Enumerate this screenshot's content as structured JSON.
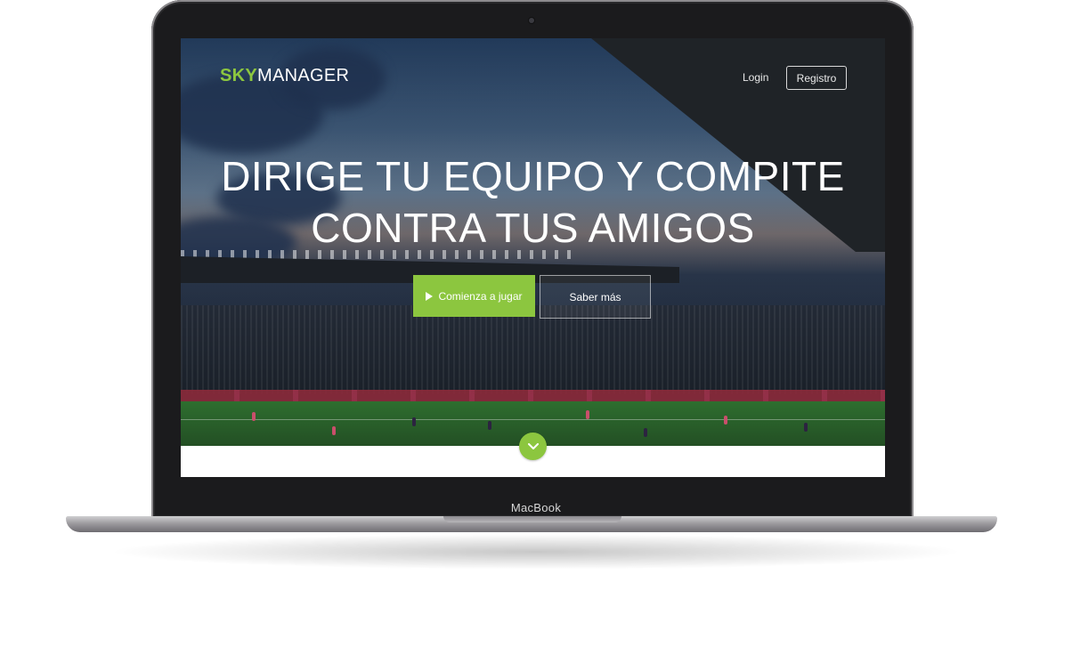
{
  "device": {
    "brand_label": "MacBook"
  },
  "header": {
    "logo_accent": "SKY",
    "logo_rest": "MANAGER",
    "login_label": "Login",
    "register_label": "Registro"
  },
  "hero": {
    "headline_line1": "DIRIGE TU EQUIPO Y COMPITE",
    "headline_line2": "CONTRA TUS AMIGOS",
    "primary_button_label": "Comienza a jugar",
    "secondary_button_label": "Saber más",
    "primary_button_icon": "play-icon",
    "scroll_icon": "chevron-down-icon"
  },
  "colors": {
    "accent": "#8cc63f",
    "text": "#ffffff"
  }
}
